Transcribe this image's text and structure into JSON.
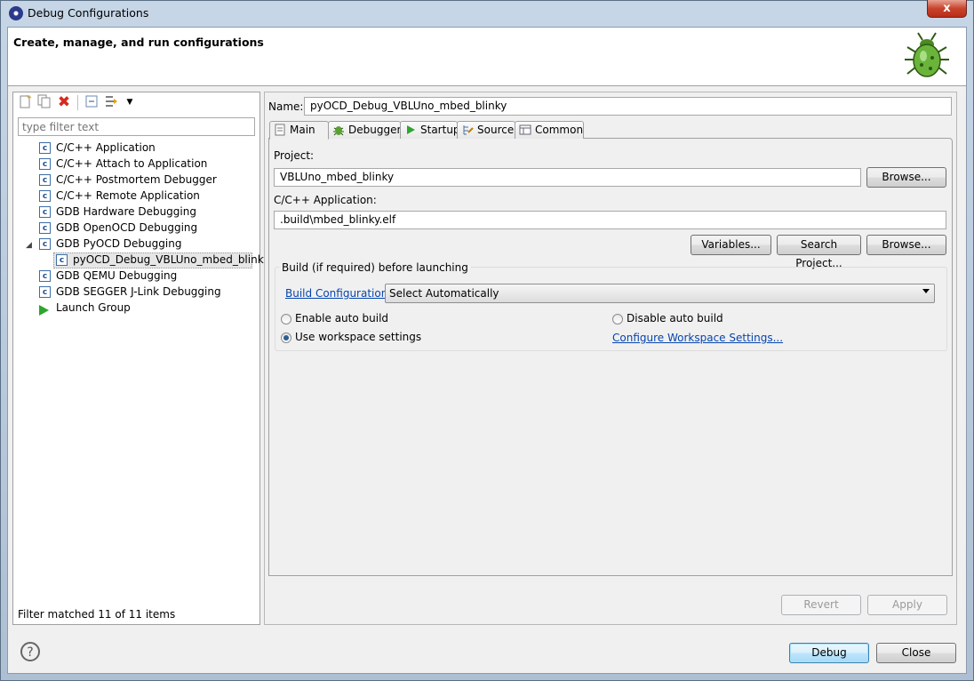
{
  "window": {
    "title": "Debug Configurations",
    "close_glyph": "x"
  },
  "header": {
    "title": "Create, manage, and run configurations"
  },
  "toolbar": {
    "icons": [
      "new-config-icon",
      "duplicate-icon",
      "delete-icon",
      "collapse-all-icon",
      "filter-icon",
      "dropdown-arrow-icon"
    ]
  },
  "filter": {
    "placeholder": "type filter text",
    "status": "Filter matched 11 of 11 items"
  },
  "tree": [
    {
      "label": "C/C++ Application"
    },
    {
      "label": "C/C++ Attach to Application"
    },
    {
      "label": "C/C++ Postmortem Debugger"
    },
    {
      "label": "C/C++ Remote Application"
    },
    {
      "label": "GDB Hardware Debugging"
    },
    {
      "label": "GDB OpenOCD Debugging"
    },
    {
      "label": "GDB PyOCD Debugging"
    },
    {
      "label": "pyOCD_Debug_VBLUno_mbed_blinky"
    },
    {
      "label": "GDB QEMU Debugging"
    },
    {
      "label": "GDB SEGGER J-Link Debugging"
    },
    {
      "label": "Launch Group"
    }
  ],
  "config": {
    "name_label": "Name:",
    "name_value": "pyOCD_Debug_VBLUno_mbed_blinky",
    "tabs": [
      "Main",
      "Debugger",
      "Startup",
      "Source",
      "Common"
    ],
    "project_label": "Project:",
    "project_value": "VBLUno_mbed_blinky",
    "app_label": "C/C++ Application:",
    "app_value": ".build\\mbed_blinky.elf",
    "browse_label": "Browse...",
    "variables_label": "Variables...",
    "search_project_label": "Search Project...",
    "build_group_title": "Build (if required) before launching",
    "build_config_link": "Build Configuration:",
    "build_config_value": "Select Automatically",
    "enable_auto_build": "Enable auto build",
    "disable_auto_build": "Disable auto build",
    "use_workspace": "Use workspace settings",
    "configure_workspace": "Configure Workspace Settings...",
    "selected_radio": "use_workspace"
  },
  "buttons": {
    "revert": "Revert",
    "apply": "Apply",
    "debug": "Debug",
    "close": "Close",
    "help": "?"
  },
  "colors": {
    "link": "#0645ad",
    "launch_green": "#2ea52e",
    "close_red": "#c7432c"
  }
}
